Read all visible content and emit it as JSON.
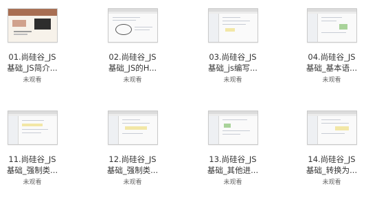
{
  "videos": [
    {
      "line1": "01.尚硅谷_JS",
      "line2": "基础_JS简介...",
      "status": "未观看"
    },
    {
      "line1": "02.尚硅谷_JS",
      "line2": "基础_JS的H...",
      "status": "未观看"
    },
    {
      "line1": "03.尚硅谷_JS",
      "line2": "基础_js编写...",
      "status": "未观看"
    },
    {
      "line1": "04.尚硅谷_JS",
      "line2": "基础_基本语...",
      "status": "未观看"
    },
    {
      "line1": "11.尚硅谷_JS",
      "line2": "基础_强制类...",
      "status": "未观看"
    },
    {
      "line1": "12.尚硅谷_JS",
      "line2": "基础_强制类...",
      "status": "未观看"
    },
    {
      "line1": "13.尚硅谷_JS",
      "line2": "基础_其他进...",
      "status": "未观看"
    },
    {
      "line1": "14.尚硅谷_JS",
      "line2": "基础_转换为...",
      "status": "未观看"
    }
  ]
}
